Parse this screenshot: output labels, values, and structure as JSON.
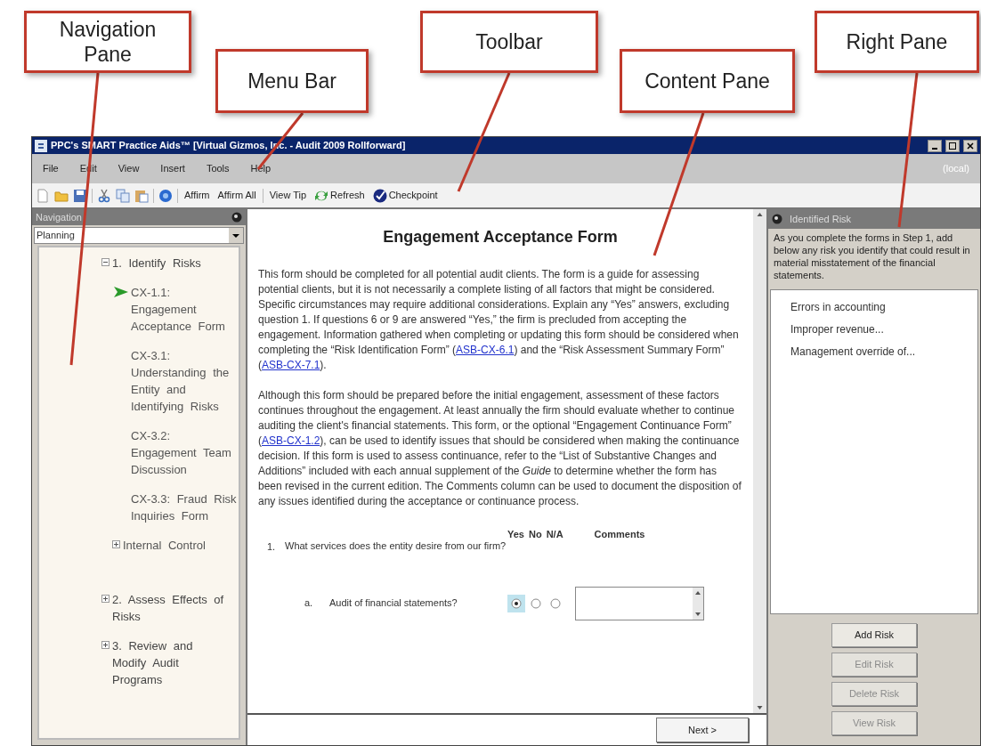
{
  "callouts": [
    {
      "label": "Navigation Pane"
    },
    {
      "label": "Menu Bar"
    },
    {
      "label": "Toolbar"
    },
    {
      "label": "Content Pane"
    },
    {
      "label": "Right Pane"
    }
  ],
  "window": {
    "title": "PPC's SMART Practice Aids™ [Virtual Gizmos, Inc. - Audit 2009 Rollforward]"
  },
  "menu_bar": {
    "items": [
      "File",
      "Edit",
      "View",
      "Insert",
      "Tools",
      "Help"
    ],
    "location": "(local)"
  },
  "toolbar": {
    "buttons": [
      {
        "label": "Affirm"
      },
      {
        "label": "Affirm All"
      },
      {
        "label": "View Tip"
      },
      {
        "label": "Refresh"
      },
      {
        "label": "Checkpoint"
      }
    ]
  },
  "navigation": {
    "title": "Navigation",
    "dropdown": "Planning",
    "tree": [
      {
        "label": "1. Identify Risks",
        "expanded": true,
        "children": [
          {
            "label": "CX-1.1: Engagement Acceptance Form",
            "selected": true
          },
          {
            "label": "CX-3.1: Understanding the Entity and Identifying Risks",
            "selected": false
          },
          {
            "label": "CX-3.2: Engagement Team Discussion",
            "selected": false
          },
          {
            "label": "CX-3.3: Fraud Risk Inquiries Form",
            "selected": false
          },
          {
            "label": "Internal Control",
            "expanded": false
          }
        ]
      },
      {
        "label": "2. Assess Effects of Risks",
        "expanded": false
      },
      {
        "label": "3. Review and Modify Audit Programs",
        "expanded": false
      }
    ]
  },
  "content": {
    "title": "Engagement Acceptance Form",
    "paragraphs": [
      [
        {
          "kind": "text",
          "text": "This form should be completed for all potential audit clients. The form is a guide for assessing potential clients, but it is not necessarily a complete listing of all factors that might be considered. Specific circumstances may require additional considerations. Explain any “Yes” answers, excluding question 1. If questions 6 or 9 are answered “Yes,” the firm is precluded from accepting the engagement. Information gathered when completing or updating this form should be considered when completing the “Risk Identification Form” ("
        },
        {
          "kind": "link",
          "text": "ASB-CX-6.1"
        },
        {
          "kind": "text",
          "text": ") and the “Risk Assessment Summary Form” ("
        },
        {
          "kind": "link",
          "text": "ASB-CX-7.1"
        },
        {
          "kind": "text",
          "text": ")."
        }
      ],
      [
        {
          "kind": "text",
          "text": "Although this form should be prepared before the initial engagement, assessment of these factors continues throughout the engagement. At least annually the firm should evaluate whether to continue auditing the client's financial statements. This form, or the optional “Engagement Continuance Form” ("
        },
        {
          "kind": "link",
          "text": "ASB-CX-1.2"
        },
        {
          "kind": "text",
          "text": "), can be used to identify issues that should be considered when making the continuance decision. If this form is used to assess continuance, refer to the “List of Substantive Changes and Additions” included with each annual supplement of the *Guide* to determine whether the form has been revised in the current edition. The Comments column can be used to document the disposition of any issues identified during the acceptance or continuance process."
        }
      ]
    ],
    "columns": [
      "Yes",
      "No",
      "N/A",
      "Comments"
    ],
    "question": {
      "number": "1.",
      "text": "What services does the entity desire from our firm?"
    },
    "sub_question": {
      "letter": "a.",
      "text": "Audit of financial statements?",
      "options": [
        {
          "selected": true
        },
        {
          "selected": false
        },
        {
          "selected": false
        }
      ]
    },
    "next_button": "Next >"
  },
  "right_pane": {
    "title": "Identified Risk",
    "instructions": "As you complete the forms in Step 1, add below any risk you identify that could result in material misstatement of the financial statements.",
    "risks": [
      "Errors in accounting",
      "Improper revenue...",
      "Management override of..."
    ],
    "buttons": [
      {
        "label": "Add Risk",
        "disabled": false
      },
      {
        "label": "Edit Risk",
        "disabled": true
      },
      {
        "label": "Delete Risk",
        "disabled": true
      },
      {
        "label": "View Risk",
        "disabled": true
      }
    ]
  }
}
